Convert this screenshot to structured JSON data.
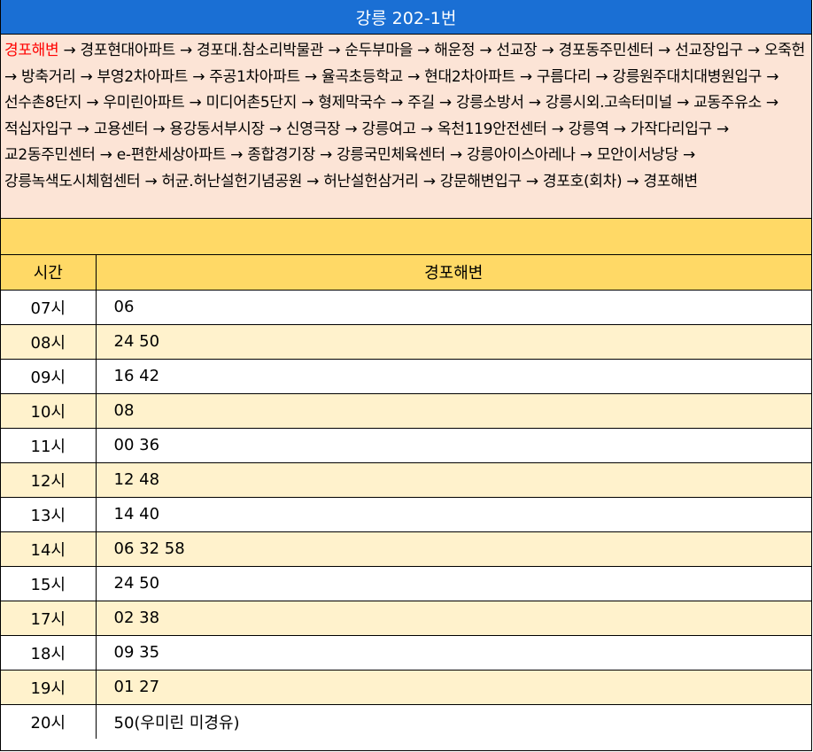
{
  "title": "강릉 202-1번",
  "route": {
    "start": "경포해변",
    "rest": " → 경포현대아파트 → 경포대.참소리박물관 → 순두부마을 → 해운정 → 선교장 → 경포동주민센터 → 선교장입구 → 오죽헌 → 방축거리 → 부영2차아파트 → 주공1차아파트 → 율곡초등학교 → 현대2차아파트 → 구름다리 → 강릉원주대치대병원입구 → 선수촌8단지 → 우미린아파트 → 미디어촌5단지 → 형제막국수 → 주길 → 강릉소방서 → 강릉시외.고속터미널 → 교동주유소 → 적십자입구 → 고용센터 → 용강동서부시장 → 신영극장 → 강릉여고 → 옥천119안전센터 → 강릉역 → 가작다리입구 → 교2동주민센터 → e-편한세상아파트 → 종합경기장 → 강릉국민체육센터 → 강릉아이스아레나 → 모안이서낭당 → 강릉녹색도시체험센터 → 허균.허난설헌기념공원 → 허난설헌삼거리 → 강문해변입구 → 경포호(회차) → 경포해변"
  },
  "table": {
    "headers": {
      "time": "시간",
      "stop": "경포해변"
    },
    "rows": [
      {
        "hour": "07시",
        "minutes": "06"
      },
      {
        "hour": "08시",
        "minutes": "24 50"
      },
      {
        "hour": "09시",
        "minutes": "16 42"
      },
      {
        "hour": "10시",
        "minutes": "08"
      },
      {
        "hour": "11시",
        "minutes": "00 36"
      },
      {
        "hour": "12시",
        "minutes": "12 48"
      },
      {
        "hour": "13시",
        "minutes": "14 40"
      },
      {
        "hour": "14시",
        "minutes": "06 32 58"
      },
      {
        "hour": "15시",
        "minutes": "24 50"
      },
      {
        "hour": "17시",
        "minutes": "02 38"
      },
      {
        "hour": "18시",
        "minutes": "09 35"
      },
      {
        "hour": "19시",
        "minutes": "01 27"
      },
      {
        "hour": "20시",
        "minutes": "50(우미린 미경유)"
      }
    ]
  },
  "colors": {
    "title_bg": "#1a6fd4",
    "route_bg": "#fce4d6",
    "start_stop": "#ff0000",
    "header_bg": "#ffd966",
    "alt_row_bg": "#fff2cc"
  }
}
